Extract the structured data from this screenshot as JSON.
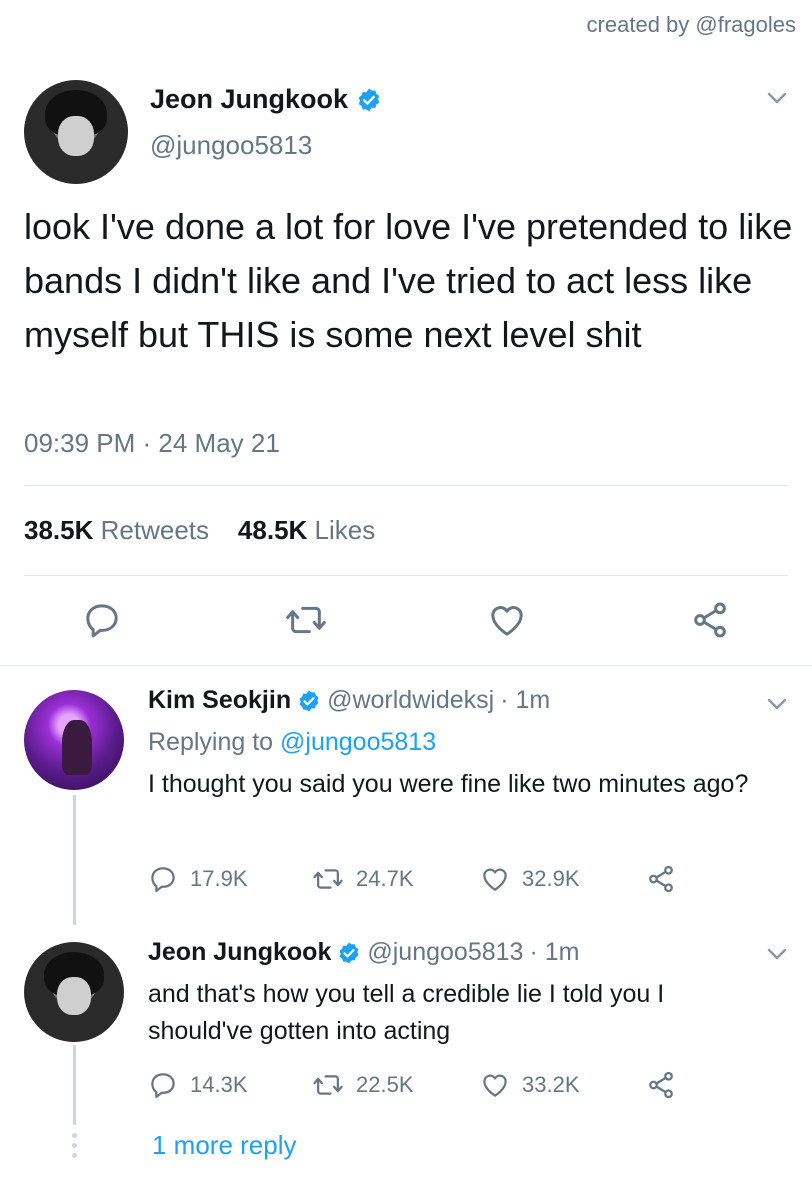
{
  "credit": "created by @fragoles",
  "main_tweet": {
    "name": "Jeon Jungkook",
    "handle": "@jungoo5813",
    "text": "look I've done a lot for love I've pretended to like bands I didn't like and I've tried to act less like myself but THIS is some next level shit",
    "timestamp": "09:39 PM · 24 May 21",
    "retweets_count": "38.5K",
    "retweets_label": "Retweets",
    "likes_count": "48.5K",
    "likes_label": "Likes",
    "icons": [
      "reply-icon",
      "retweet-icon",
      "like-icon",
      "share-icon"
    ]
  },
  "replies": [
    {
      "name": "Kim Seokjin",
      "handle": "@worldwideksj",
      "time": "· 1m",
      "replying_prefix": "Replying to",
      "replying_handle": "@jungoo5813",
      "text": "I thought you said you were fine like two minutes ago?",
      "reply_count": "17.9K",
      "retweet_count": "24.7K",
      "like_count": "32.9K"
    },
    {
      "name": "Jeon Jungkook",
      "handle": "@jungoo5813",
      "time": "· 1m",
      "text": "and that's how you tell a credible lie I told you I should've gotten into acting",
      "reply_count": "14.3K",
      "retweet_count": "22.5K",
      "like_count": "33.2K"
    }
  ],
  "more_replies": "1 more reply",
  "colors": {
    "accent": "#1da1f2",
    "secondary_text": "#657786",
    "primary_text": "#14171a",
    "divider": "#e1e8ed"
  }
}
